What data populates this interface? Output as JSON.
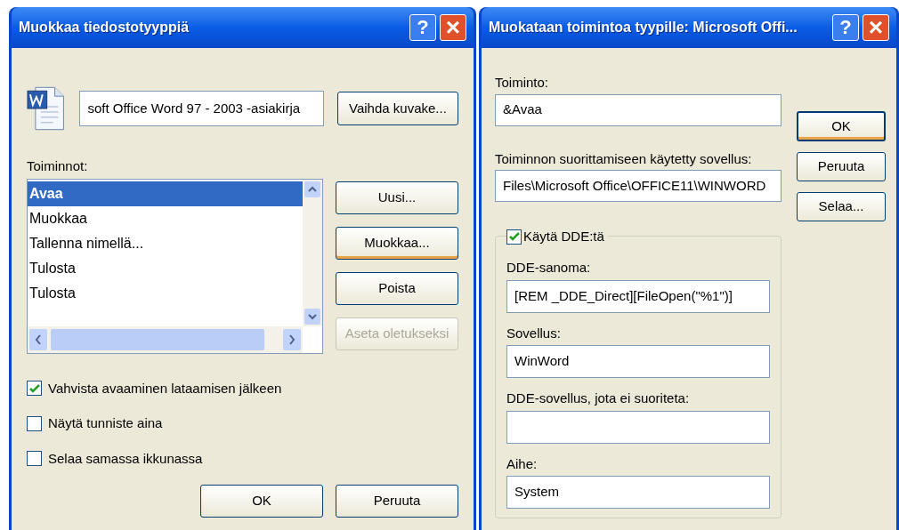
{
  "file_type_dialog": {
    "title": "Muokkaa tiedostotyyppiä",
    "help": "?",
    "close": "×",
    "type_name": "soft Office Word 97 - 2003 -asiakirja",
    "change_icon_button": "Vaihda kuvake...",
    "actions_label": "Toiminnot:",
    "actions": [
      {
        "label": "Avaa",
        "selected": true
      },
      {
        "label": "Muokkaa",
        "selected": false
      },
      {
        "label": "Tallenna nimellä...",
        "selected": false
      },
      {
        "label": "Tulosta",
        "selected": false
      },
      {
        "label": "Tulosta",
        "selected": false
      }
    ],
    "side_buttons": [
      {
        "label": "Uusi...",
        "focused": false,
        "disabled": false
      },
      {
        "label": "Muokkaa...",
        "focused": true,
        "disabled": false
      },
      {
        "label": "Poista",
        "focused": false,
        "disabled": false
      },
      {
        "label": "Aseta oletukseksi",
        "focused": false,
        "disabled": true
      }
    ],
    "options": [
      {
        "label": "Vahvista avaaminen lataamisen jälkeen",
        "checked": true
      },
      {
        "label": "Näytä tunniste aina",
        "checked": false
      },
      {
        "label": "Selaa samassa ikkunassa",
        "checked": false
      }
    ],
    "ok": "OK",
    "cancel": "Peruuta"
  },
  "action_dialog": {
    "title": "Muokataan toimintoa tyypille: Microsoft Offi...",
    "help": "?",
    "close": "×",
    "action_label": "Toiminto:",
    "action_value": "&Avaa",
    "app_label": "Toiminnon suorittamiseen käytetty sovellus:",
    "app_value": "Files\\Microsoft Office\\OFFICE11\\WINWORD",
    "ok": "OK",
    "cancel": "Peruuta",
    "browse": "Selaa...",
    "dde": {
      "label": "Käytä DDE:tä",
      "checked": true,
      "fields": [
        {
          "label": "DDE-sanoma:",
          "value": "[REM _DDE_Direct][FileOpen(\"%1\")]"
        },
        {
          "label": "Sovellus:",
          "value": "WinWord"
        },
        {
          "label": "DDE-sovellus, jota ei suoriteta:"
        },
        {
          "label": "Aihe:",
          "value": "System"
        }
      ]
    }
  }
}
